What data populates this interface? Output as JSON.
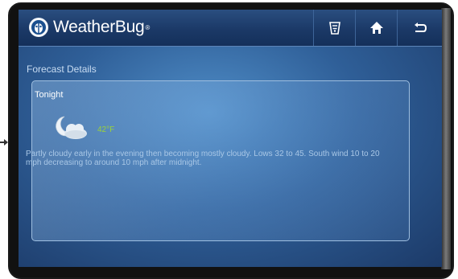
{
  "app": {
    "brand": "WeatherBug",
    "brand_mark": "®"
  },
  "toolbar": {
    "buttons": [
      {
        "name": "sensor-icon"
      },
      {
        "name": "home-icon"
      },
      {
        "name": "back-icon"
      }
    ]
  },
  "section": {
    "title": "Forecast Details"
  },
  "forecast": {
    "period": "Tonight",
    "icon": "partly-cloudy-night-icon",
    "temperature": "42°F",
    "description": "Partly cloudy early in the evening then becoming mostly cloudy. Lows 32 to 45. South wind 10 to 20 mph decreasing to around 10 mph after midnight."
  },
  "colors": {
    "topbar": "#1b3967",
    "screen": "#2f5f98",
    "temperature": "#9ad23a",
    "description": "#a9c7e6"
  }
}
